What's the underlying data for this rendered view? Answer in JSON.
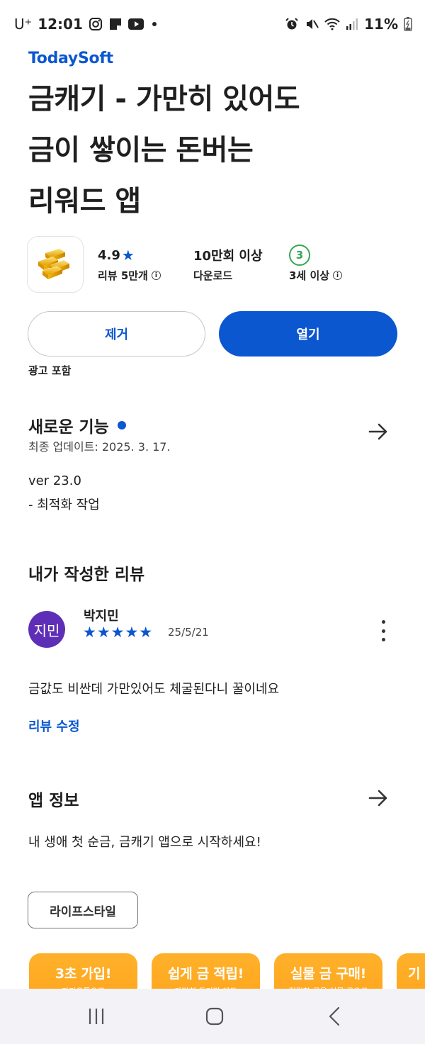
{
  "status_bar": {
    "carrier": "U⁺",
    "time": "12:01",
    "battery": "11%"
  },
  "app": {
    "developer": "TodaySoft",
    "title_lines": [
      "금캐기 - 가만히 있어도",
      "금이 쌓이는 돈버는",
      "리워드 앱"
    ],
    "rating": "4.9",
    "rating_star": "★",
    "reviews_label": "리뷰 5만개",
    "downloads": "10만회 이상",
    "downloads_label": "다운로드",
    "age_badge": "3",
    "age_label": "3세 이상"
  },
  "actions": {
    "remove_label": "제거",
    "open_label": "열기",
    "ads_label": "광고 포함"
  },
  "whats_new": {
    "title": "새로운 기능",
    "last_updated": "최종 업데이트: 2025. 3. 17.",
    "version": "ver 23.0",
    "notes": "- 최적화 작업"
  },
  "my_review": {
    "title": "내가 작성한 리뷰",
    "avatar_text": "지민",
    "reviewer": "박지민",
    "stars": "★★★★★",
    "rating": 5,
    "date": "25/5/21",
    "text": "금값도 비싼데 가만있어도 체굴된다니 꿀이네요",
    "edit_label": "리뷰 수정"
  },
  "about": {
    "title": "앱 정보",
    "description": "내 생애 첫 순금, 금캐기 앱으로 시작하세요!",
    "category": "라이프스타일"
  },
  "screenshots": [
    {
      "headline": "3초 가입!",
      "sub": "카카오톡으로"
    },
    {
      "headline": "쉽게 금 적립!",
      "sub": "가만히 두기만 해도"
    },
    {
      "headline": "실물 금 구매!",
      "sub": "적립한 금을 실물 금으로"
    },
    {
      "headline": "기",
      "sub": ""
    }
  ],
  "colors": {
    "accent": "#0b57d0",
    "avatar": "#5f2eb7",
    "age_badge": "#34a853",
    "screenshot_bg": "#ffa31a"
  },
  "icons": [
    "instagram-icon",
    "notification-icon",
    "youtube-icon",
    "alarm-icon",
    "mute-icon",
    "wifi-icon",
    "signal-icon",
    "battery-icon",
    "info-icon",
    "arrow-right-icon",
    "more-vert-icon",
    "recents-icon",
    "home-icon",
    "back-icon"
  ]
}
